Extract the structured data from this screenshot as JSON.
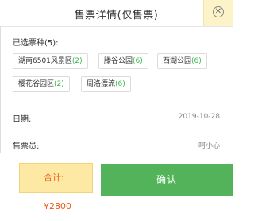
{
  "dialog": {
    "title": "售票详情(仅售票)",
    "selected_label": "已选票种(5):",
    "tickets": [
      {
        "name": "湖南6501风景区",
        "count": "(2)"
      },
      {
        "name": "滕谷公园",
        "count": "(6)"
      },
      {
        "name": "西湖公园",
        "count": "(6)"
      },
      {
        "name": "樱花谷园区",
        "count": "(2)"
      },
      {
        "name": "周洛漂流",
        "count": "(6)"
      }
    ],
    "date_label": "日期:",
    "date_value": "2019-10-28",
    "seller_label": "售票员:",
    "seller_value": "呵小心",
    "total_text": "合计: ¥2800",
    "confirm_label": "确认"
  },
  "colors": {
    "confirm_bg": "#52b35a",
    "total_bg": "#fde9a3",
    "total_text": "#f05a1a",
    "count_text": "#3ab54a"
  },
  "icons": {
    "close": "close-circle-icon"
  }
}
